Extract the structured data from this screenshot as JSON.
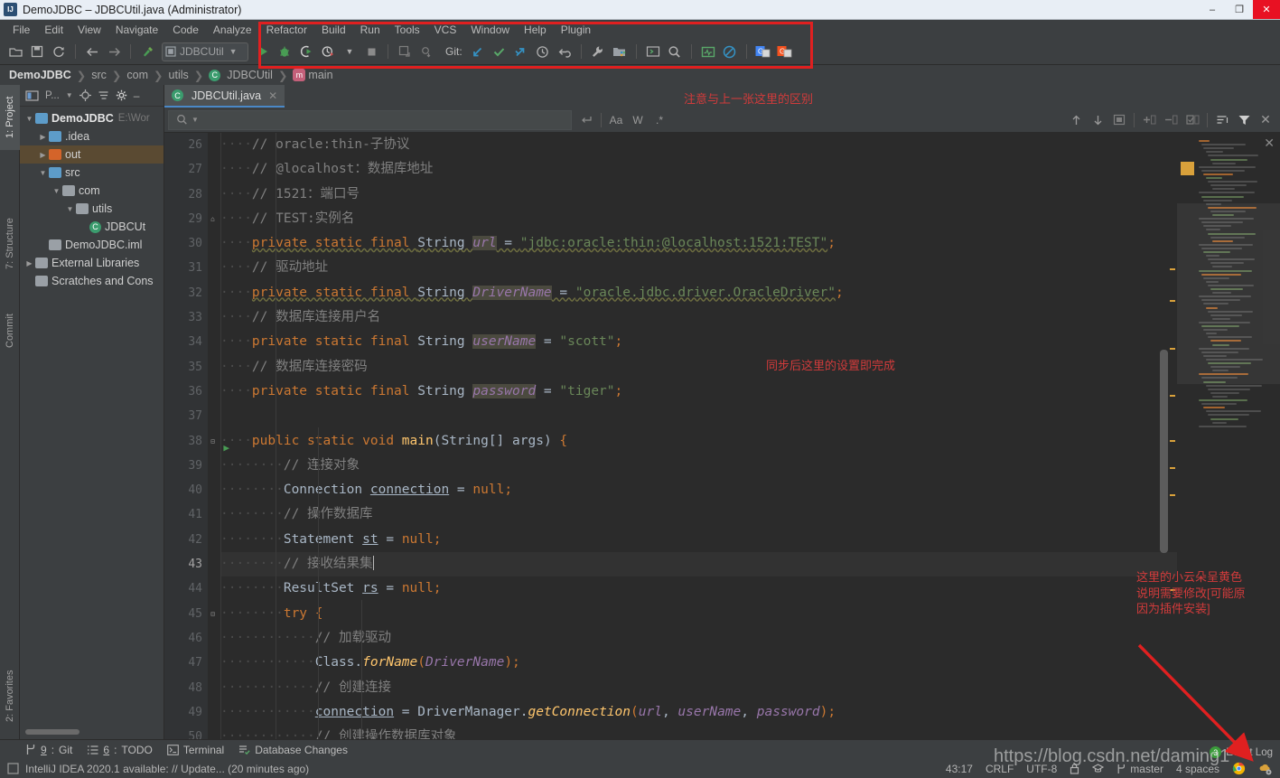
{
  "window": {
    "title": "DemoJDBC – JDBCUtil.java (Administrator)",
    "app_icon": "intellij-idea-icon",
    "minimize": "–",
    "maximize": "❐",
    "close": "✕"
  },
  "menubar": {
    "items": [
      "File",
      "Edit",
      "View",
      "Navigate",
      "Code",
      "Analyze",
      "Refactor",
      "Build",
      "Run",
      "Tools",
      "VCS",
      "Window",
      "Help",
      "Plugin"
    ]
  },
  "toolbar": {
    "run_config": "JDBCUtil",
    "git_label": "Git:",
    "icons": [
      "open-folder-icon",
      "save-all-icon",
      "sync-icon",
      "back-arrow-icon",
      "forward-arrow-icon",
      "build-hammer-icon",
      "run-icon",
      "debug-icon",
      "run-coverage-icon",
      "profiler-icon",
      "stop-icon",
      "update-project-icon",
      "commit-icon",
      "git-pull-icon",
      "git-commit-check-icon",
      "git-push-icon",
      "git-history-icon",
      "git-revert-icon",
      "settings-wrench-icon",
      "project-structure-icon",
      "console-icon",
      "search-everywhere-icon",
      "monitor-green-icon",
      "no-entry-icon",
      "google-translate-blue-icon",
      "google-translate-orange-icon"
    ]
  },
  "breadcrumb": {
    "items": [
      "DemoJDBC",
      "src",
      "com",
      "utils",
      "JDBCUtil",
      "main"
    ]
  },
  "rail": {
    "left": [
      "1: Project",
      "7: Structure",
      "Commit",
      "2: Favorites"
    ]
  },
  "project_panel": {
    "title": "P...",
    "header_icons": [
      "project-view-icon",
      "locate-icon",
      "collapse-all-icon",
      "gear-icon",
      "hide-icon"
    ],
    "tree": [
      {
        "label": "DemoJDBC",
        "path": "E:\\Wor",
        "depth": 0,
        "arrow": "▼",
        "icon": "module-icon",
        "bold": true,
        "selected": false
      },
      {
        "label": ".idea",
        "path": "",
        "depth": 1,
        "arrow": "▶",
        "icon": "folder-blue-icon",
        "bold": false,
        "selected": false
      },
      {
        "label": "out",
        "path": "",
        "depth": 1,
        "arrow": "▶",
        "icon": "folder-orange-icon",
        "bold": false,
        "selected": true
      },
      {
        "label": "src",
        "path": "",
        "depth": 1,
        "arrow": "▼",
        "icon": "folder-blue-icon",
        "bold": false,
        "selected": false
      },
      {
        "label": "com",
        "path": "",
        "depth": 2,
        "arrow": "▼",
        "icon": "package-icon",
        "bold": false,
        "selected": false
      },
      {
        "label": "utils",
        "path": "",
        "depth": 3,
        "arrow": "▼",
        "icon": "package-icon",
        "bold": false,
        "selected": false
      },
      {
        "label": "JDBCUt",
        "path": "",
        "depth": 4,
        "arrow": "",
        "icon": "java-class-icon",
        "bold": false,
        "selected": false
      },
      {
        "label": "DemoJDBC.iml",
        "path": "",
        "depth": 1,
        "arrow": "",
        "icon": "iml-file-icon",
        "bold": false,
        "selected": false
      },
      {
        "label": "External Libraries",
        "path": "",
        "depth": 0,
        "arrow": "▶",
        "icon": "libraries-icon",
        "bold": false,
        "selected": false
      },
      {
        "label": "Scratches and Cons",
        "path": "",
        "depth": 0,
        "arrow": "",
        "icon": "scratches-icon",
        "bold": false,
        "selected": false
      }
    ]
  },
  "editor": {
    "tab": {
      "label": "JDBCUtil.java",
      "icon": "java-class-icon",
      "close": "✕"
    },
    "findbar": {
      "placeholder": "",
      "search_icon": "magnifier-icon",
      "buttons": [
        "regex-newline-icon",
        "Aa",
        "W",
        ".*",
        "arrow-up-icon",
        "arrow-down-icon",
        "select-all-icon",
        "add-selection-icon",
        "remove-selection-icon",
        "select-occurrences-icon",
        "filter-lines-icon",
        "filter-icon"
      ]
    },
    "first_line": 26,
    "lines": [
      {
        "n": 26,
        "fold": "",
        "run": false,
        "cur": false,
        "tokens": [
          {
            "t": "····",
            "c": "dots"
          },
          {
            "t": "// oracle:thin-子协议",
            "c": "cmt"
          }
        ]
      },
      {
        "n": 27,
        "fold": "",
        "run": false,
        "cur": false,
        "tokens": [
          {
            "t": "····",
            "c": "dots"
          },
          {
            "t": "// @localhost：数据库地址",
            "c": "cmt"
          }
        ]
      },
      {
        "n": 28,
        "fold": "",
        "run": false,
        "cur": false,
        "tokens": [
          {
            "t": "····",
            "c": "dots"
          },
          {
            "t": "// 1521：端口号",
            "c": "cmt"
          }
        ]
      },
      {
        "n": 29,
        "fold": "⌂",
        "run": false,
        "cur": false,
        "tokens": [
          {
            "t": "····",
            "c": "dots"
          },
          {
            "t": "// TEST:实例名",
            "c": "cmt"
          }
        ]
      },
      {
        "n": 30,
        "fold": "",
        "run": false,
        "cur": false,
        "tokens": [
          {
            "t": "····",
            "c": "dots"
          },
          {
            "t": "private static final ",
            "c": "kw err"
          },
          {
            "t": "String ",
            "c": "typ err"
          },
          {
            "t": "url",
            "c": "fld-hl"
          },
          {
            "t": " = ",
            "c": "pun err"
          },
          {
            "t": "\"jdbc:oracle:thin:@localhost:1521:TEST\"",
            "c": "str err"
          },
          {
            "t": ";",
            "c": "semi"
          }
        ]
      },
      {
        "n": 31,
        "fold": "",
        "run": false,
        "cur": false,
        "tokens": [
          {
            "t": "····",
            "c": "dots"
          },
          {
            "t": "// 驱动地址",
            "c": "cmt"
          }
        ]
      },
      {
        "n": 32,
        "fold": "",
        "run": false,
        "cur": false,
        "tokens": [
          {
            "t": "····",
            "c": "dots"
          },
          {
            "t": "private static final ",
            "c": "kw err"
          },
          {
            "t": "String ",
            "c": "typ err"
          },
          {
            "t": "DriverName",
            "c": "fld-hl"
          },
          {
            "t": " = ",
            "c": "pun err"
          },
          {
            "t": "\"oracle.jdbc.driver.OracleDriver\"",
            "c": "str err"
          },
          {
            "t": ";",
            "c": "semi"
          }
        ]
      },
      {
        "n": 33,
        "fold": "",
        "run": false,
        "cur": false,
        "tokens": [
          {
            "t": "····",
            "c": "dots"
          },
          {
            "t": "// 数据库连接用户名",
            "c": "cmt"
          }
        ]
      },
      {
        "n": 34,
        "fold": "",
        "run": false,
        "cur": false,
        "tokens": [
          {
            "t": "····",
            "c": "dots"
          },
          {
            "t": "private static final ",
            "c": "kw"
          },
          {
            "t": "String ",
            "c": "typ"
          },
          {
            "t": "userName",
            "c": "fld-hl"
          },
          {
            "t": " = ",
            "c": "pun"
          },
          {
            "t": "\"scott\"",
            "c": "str"
          },
          {
            "t": ";",
            "c": "semi"
          }
        ]
      },
      {
        "n": 35,
        "fold": "",
        "run": false,
        "cur": false,
        "tokens": [
          {
            "t": "····",
            "c": "dots"
          },
          {
            "t": "// 数据库连接密码",
            "c": "cmt"
          }
        ]
      },
      {
        "n": 36,
        "fold": "",
        "run": false,
        "cur": false,
        "tokens": [
          {
            "t": "····",
            "c": "dots"
          },
          {
            "t": "private static final ",
            "c": "kw"
          },
          {
            "t": "String ",
            "c": "typ"
          },
          {
            "t": "password",
            "c": "fld-hl"
          },
          {
            "t": " = ",
            "c": "pun"
          },
          {
            "t": "\"tiger\"",
            "c": "str"
          },
          {
            "t": ";",
            "c": "semi"
          }
        ]
      },
      {
        "n": 37,
        "fold": "",
        "run": false,
        "cur": false,
        "tokens": []
      },
      {
        "n": 38,
        "fold": "⊟",
        "run": true,
        "cur": false,
        "tokens": [
          {
            "t": "····",
            "c": "dots"
          },
          {
            "t": "public static void ",
            "c": "kw"
          },
          {
            "t": "main",
            "c": "mth"
          },
          {
            "t": "(",
            "c": "pun"
          },
          {
            "t": "String[] args",
            "c": "typ"
          },
          {
            "t": ") ",
            "c": "pun"
          },
          {
            "t": "{",
            "c": "semi"
          }
        ]
      },
      {
        "n": 39,
        "fold": "",
        "run": false,
        "cur": false,
        "tokens": [
          {
            "t": "········",
            "c": "dots"
          },
          {
            "t": "// 连接对象",
            "c": "cmt"
          }
        ]
      },
      {
        "n": 40,
        "fold": "",
        "run": false,
        "cur": false,
        "tokens": [
          {
            "t": "········",
            "c": "dots"
          },
          {
            "t": "Connection ",
            "c": "typ"
          },
          {
            "t": "connection",
            "c": "stat"
          },
          {
            "t": " = ",
            "c": "pun"
          },
          {
            "t": "null",
            "c": "kw"
          },
          {
            "t": ";",
            "c": "semi"
          }
        ]
      },
      {
        "n": 41,
        "fold": "",
        "run": false,
        "cur": false,
        "tokens": [
          {
            "t": "········",
            "c": "dots"
          },
          {
            "t": "// 操作数据库",
            "c": "cmt"
          }
        ]
      },
      {
        "n": 42,
        "fold": "",
        "run": false,
        "cur": false,
        "tokens": [
          {
            "t": "········",
            "c": "dots"
          },
          {
            "t": "Statement ",
            "c": "typ"
          },
          {
            "t": "st",
            "c": "stat"
          },
          {
            "t": " = ",
            "c": "pun"
          },
          {
            "t": "null",
            "c": "kw"
          },
          {
            "t": ";",
            "c": "semi"
          }
        ]
      },
      {
        "n": 43,
        "fold": "",
        "run": false,
        "cur": true,
        "tokens": [
          {
            "t": "········",
            "c": "dots"
          },
          {
            "t": "// 接收结果集",
            "c": "cmt"
          },
          {
            "t": "|",
            "c": "caret"
          }
        ]
      },
      {
        "n": 44,
        "fold": "",
        "run": false,
        "cur": false,
        "tokens": [
          {
            "t": "········",
            "c": "dots"
          },
          {
            "t": "ResultSet ",
            "c": "typ"
          },
          {
            "t": "rs",
            "c": "stat"
          },
          {
            "t": " = ",
            "c": "pun"
          },
          {
            "t": "null",
            "c": "kw"
          },
          {
            "t": ";",
            "c": "semi"
          }
        ]
      },
      {
        "n": 45,
        "fold": "⊟",
        "run": false,
        "cur": false,
        "tokens": [
          {
            "t": "········",
            "c": "dots"
          },
          {
            "t": "try ",
            "c": "kw"
          },
          {
            "t": "{",
            "c": "semi"
          }
        ]
      },
      {
        "n": 46,
        "fold": "",
        "run": false,
        "cur": false,
        "tokens": [
          {
            "t": "············",
            "c": "dots"
          },
          {
            "t": "// 加载驱动",
            "c": "cmt"
          }
        ]
      },
      {
        "n": 47,
        "fold": "",
        "run": false,
        "cur": false,
        "tokens": [
          {
            "t": "············",
            "c": "dots"
          },
          {
            "t": "Class",
            "c": "typ"
          },
          {
            "t": ".",
            "c": "pun"
          },
          {
            "t": "forName",
            "c": "mthi"
          },
          {
            "t": "(",
            "c": "semi"
          },
          {
            "t": "DriverName",
            "c": "fld"
          },
          {
            "t": ")",
            "c": "semi"
          },
          {
            "t": ";",
            "c": "semi"
          }
        ]
      },
      {
        "n": 48,
        "fold": "",
        "run": false,
        "cur": false,
        "tokens": [
          {
            "t": "············",
            "c": "dots"
          },
          {
            "t": "// 创建连接",
            "c": "cmt"
          }
        ]
      },
      {
        "n": 49,
        "fold": "",
        "run": false,
        "cur": false,
        "tokens": [
          {
            "t": "············",
            "c": "dots"
          },
          {
            "t": "connection",
            "c": "stat"
          },
          {
            "t": " = ",
            "c": "pun"
          },
          {
            "t": "DriverManager",
            "c": "typ"
          },
          {
            "t": ".",
            "c": "pun"
          },
          {
            "t": "getConnection",
            "c": "mthi"
          },
          {
            "t": "(",
            "c": "semi"
          },
          {
            "t": "url",
            "c": "fld"
          },
          {
            "t": ", ",
            "c": "pun"
          },
          {
            "t": "userName",
            "c": "fld"
          },
          {
            "t": ", ",
            "c": "pun"
          },
          {
            "t": "password",
            "c": "fld"
          },
          {
            "t": ")",
            "c": "semi"
          },
          {
            "t": ";",
            "c": "semi"
          }
        ]
      },
      {
        "n": 50,
        "fold": "",
        "run": false,
        "cur": false,
        "tokens": [
          {
            "t": "············",
            "c": "dots"
          },
          {
            "t": "// 创建操作数据库对象",
            "c": "cmt"
          }
        ]
      }
    ]
  },
  "bottom": {
    "toolwindows": [
      {
        "num": "9",
        "label": "Git",
        "icon": "git-branch-icon"
      },
      {
        "num": "6",
        "label": "TODO",
        "icon": "todo-list-icon"
      },
      {
        "num": "",
        "label": "Terminal",
        "icon": "terminal-icon"
      },
      {
        "num": "",
        "label": "Database Changes",
        "icon": "database-changes-icon"
      }
    ],
    "status_message": "IntelliJ IDEA 2020.1 available: // Update... (20 minutes ago)",
    "status_icon": "notification-icon",
    "event_log": {
      "label": "Event Log",
      "count": "3"
    },
    "right": {
      "caret": "43:17",
      "line_sep": "CRLF",
      "encoding": "UTF-8",
      "lock_icon": "lock-icon",
      "inspection_icon": "inspection-hat-icon",
      "branch_icon": "git-branch-icon",
      "branch": "master",
      "indent": "4 spaces",
      "chrome_icon": "chrome-icon",
      "settings_icon": "settings-cloud-icon"
    }
  },
  "annotations": {
    "toolbar_note": "注意与上一张这里的区别",
    "middle_note": "同步后这里的设置即完成",
    "cloud_note": "这里的小云朵呈黄色\n说明需要修改[可能原\n因为插件安装]",
    "watermark": "https://blog.csdn.net/daming1",
    "accent_red": "#e02020"
  }
}
